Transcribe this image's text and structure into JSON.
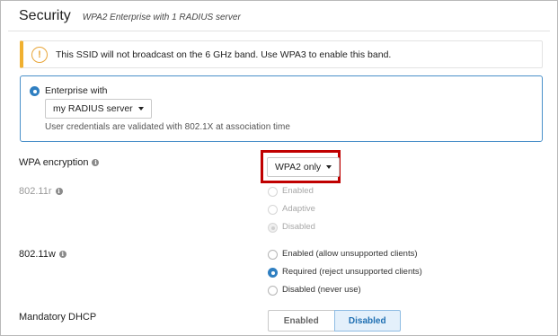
{
  "header": {
    "title": "Security",
    "subtitle": "WPA2 Enterprise with 1 RADIUS server"
  },
  "notice": {
    "message": "This SSID will not broadcast on the 6 GHz band. Use WPA3 to enable this band.",
    "icon": "warning-icon",
    "accent_color": "#f0b030"
  },
  "enterprise": {
    "label": "Enterprise with",
    "selected": true,
    "radius_dropdown": "my RADIUS server",
    "help": "User credentials are validated with 802.1X at association time",
    "border_color": "#4a90c9"
  },
  "wpa_encryption": {
    "label": "WPA encryption",
    "value": "WPA2 only",
    "highlight_color": "#c00000"
  },
  "dot11r": {
    "label": "802.11r",
    "disabled": true,
    "options": [
      {
        "label": "Enabled",
        "selected": false
      },
      {
        "label": "Adaptive",
        "selected": false
      },
      {
        "label": "Disabled",
        "selected": true
      }
    ]
  },
  "dot11w": {
    "label": "802.11w",
    "options": [
      {
        "label": "Enabled (allow unsupported clients)",
        "selected": false
      },
      {
        "label": "Required (reject unsupported clients)",
        "selected": true
      },
      {
        "label": "Disabled (never use)",
        "selected": false
      }
    ]
  },
  "mandatory_dhcp": {
    "label": "Mandatory DHCP",
    "options": [
      "Enabled",
      "Disabled"
    ],
    "selected": "Disabled"
  }
}
